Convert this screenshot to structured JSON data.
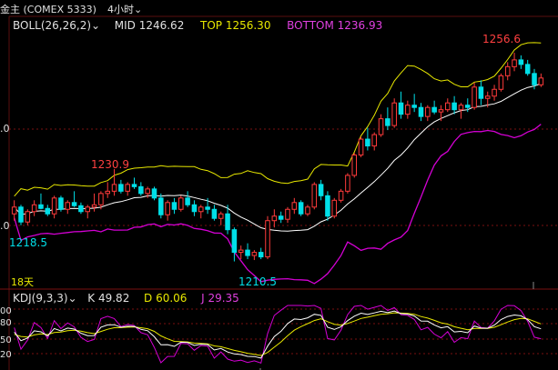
{
  "header": {
    "instrument": "金主 (COMEX 5333)",
    "period": "4小时",
    "period_dropdown_icon": "chevron-down-icon"
  },
  "boll": {
    "label": "BOLL(26,26,2)",
    "mid_label": "MID",
    "mid_value": "1246.62",
    "top_label": "TOP",
    "top_value": "1256.30",
    "bottom_label": "BOTTOM",
    "bottom_value": "1236.93"
  },
  "kdj": {
    "label": "KDJ(9,3,3)",
    "k_label": "K",
    "k_value": "49.82",
    "d_label": "D",
    "d_value": "60.06",
    "j_label": "J",
    "j_value": "29.35"
  },
  "y_ticks": {
    "upper": ".0",
    "lower": ".0",
    "kdj_ticks": [
      "00",
      "80",
      "50",
      "20"
    ]
  },
  "annotations": {
    "high_left": "1230.9",
    "low_left": "1218.5",
    "low_mid": "1210.5",
    "high_right": "1256.6",
    "period_count": "18天"
  },
  "colors": {
    "background": "#000000",
    "up_candle": "#ff3b3b",
    "down_candle": "#00dfe8",
    "mid_line": "#ffffff",
    "top_line": "#e8e800",
    "bottom_line": "#d400d4",
    "grid_red": "#7a1010",
    "text_white": "#e0e0e0",
    "text_yellow": "#e8e800",
    "text_magenta": "#e040e0",
    "text_red": "#ff4040",
    "text_cyan": "#00dfe8"
  },
  "chart_data": {
    "type": "candlestick",
    "title": "",
    "series": [
      {
        "name": "MID",
        "value_last": 1246.62
      },
      {
        "name": "TOP",
        "value_last": 1256.3
      },
      {
        "name": "BOTTOM",
        "value_last": 1236.93
      }
    ],
    "price_range": [
      1208,
      1261
    ],
    "candles_ohlc": [
      [
        1221.0,
        1224.0,
        1219.5,
        1222.5
      ],
      [
        1222.5,
        1223.0,
        1218.5,
        1219.2
      ],
      [
        1219.2,
        1222.0,
        1218.5,
        1221.5
      ],
      [
        1221.5,
        1224.0,
        1220.5,
        1223.0
      ],
      [
        1223.0,
        1225.5,
        1222.0,
        1222.2
      ],
      [
        1222.2,
        1223.0,
        1220.5,
        1221.0
      ],
      [
        1221.0,
        1225.0,
        1220.0,
        1224.5
      ],
      [
        1224.5,
        1225.0,
        1221.5,
        1222.0
      ],
      [
        1222.0,
        1224.0,
        1221.0,
        1223.5
      ],
      [
        1223.5,
        1226.0,
        1222.5,
        1222.8
      ],
      [
        1222.8,
        1223.5,
        1221.0,
        1221.5
      ],
      [
        1221.5,
        1223.0,
        1220.0,
        1222.5
      ],
      [
        1222.5,
        1225.5,
        1221.5,
        1223.0
      ],
      [
        1223.0,
        1226.0,
        1222.0,
        1225.5
      ],
      [
        1225.5,
        1228.0,
        1224.5,
        1226.0
      ],
      [
        1226.0,
        1230.9,
        1225.0,
        1227.5
      ],
      [
        1227.5,
        1228.5,
        1225.5,
        1226.0
      ],
      [
        1226.0,
        1228.0,
        1225.0,
        1227.5
      ],
      [
        1227.5,
        1229.0,
        1226.5,
        1227.0
      ],
      [
        1227.0,
        1228.0,
        1225.0,
        1225.5
      ],
      [
        1225.5,
        1227.0,
        1224.5,
        1226.5
      ],
      [
        1226.5,
        1227.0,
        1224.0,
        1224.5
      ],
      [
        1224.5,
        1225.5,
        1220.0,
        1220.8
      ],
      [
        1220.8,
        1224.0,
        1219.5,
        1223.5
      ],
      [
        1223.5,
        1224.5,
        1221.0,
        1222.0
      ],
      [
        1222.0,
        1225.0,
        1221.5,
        1224.5
      ],
      [
        1224.5,
        1226.0,
        1222.5,
        1223.0
      ],
      [
        1223.0,
        1224.0,
        1220.5,
        1221.5
      ],
      [
        1221.5,
        1223.0,
        1220.0,
        1222.5
      ],
      [
        1222.5,
        1224.5,
        1221.0,
        1222.0
      ],
      [
        1222.0,
        1223.0,
        1219.5,
        1220.0
      ],
      [
        1220.0,
        1221.5,
        1218.5,
        1221.0
      ],
      [
        1221.0,
        1223.0,
        1216.5,
        1217.5
      ],
      [
        1217.5,
        1218.0,
        1210.5,
        1212.5
      ],
      [
        1212.5,
        1214.0,
        1211.0,
        1213.0
      ],
      [
        1213.0,
        1214.5,
        1211.0,
        1211.8
      ],
      [
        1211.8,
        1213.0,
        1210.8,
        1212.5
      ],
      [
        1212.5,
        1213.5,
        1211.0,
        1211.5
      ],
      [
        1211.5,
        1220.5,
        1211.0,
        1219.5
      ],
      [
        1219.5,
        1222.0,
        1218.0,
        1220.5
      ],
      [
        1220.5,
        1221.5,
        1219.0,
        1219.8
      ],
      [
        1219.8,
        1222.5,
        1219.0,
        1222.0
      ],
      [
        1222.0,
        1224.5,
        1221.0,
        1223.5
      ],
      [
        1223.5,
        1224.0,
        1220.5,
        1221.0
      ],
      [
        1221.0,
        1223.0,
        1220.5,
        1222.5
      ],
      [
        1222.5,
        1228.0,
        1222.0,
        1227.5
      ],
      [
        1227.5,
        1228.5,
        1224.0,
        1225.0
      ],
      [
        1225.0,
        1226.0,
        1219.5,
        1220.5
      ],
      [
        1220.5,
        1224.5,
        1220.0,
        1224.0
      ],
      [
        1224.0,
        1226.5,
        1223.5,
        1226.0
      ],
      [
        1226.0,
        1230.0,
        1225.5,
        1229.5
      ],
      [
        1229.5,
        1234.5,
        1229.0,
        1234.0
      ],
      [
        1234.0,
        1238.0,
        1233.5,
        1237.5
      ],
      [
        1237.5,
        1240.0,
        1235.0,
        1236.0
      ],
      [
        1236.0,
        1239.0,
        1235.0,
        1238.5
      ],
      [
        1238.5,
        1243.0,
        1238.0,
        1242.0
      ],
      [
        1242.0,
        1244.5,
        1239.5,
        1240.5
      ],
      [
        1240.5,
        1246.5,
        1240.0,
        1245.5
      ],
      [
        1245.5,
        1248.0,
        1242.0,
        1243.0
      ],
      [
        1243.0,
        1246.0,
        1242.0,
        1245.0
      ],
      [
        1245.0,
        1247.5,
        1243.5,
        1244.5
      ],
      [
        1244.5,
        1245.5,
        1241.5,
        1242.5
      ],
      [
        1242.5,
        1245.0,
        1241.5,
        1244.5
      ],
      [
        1244.5,
        1246.0,
        1243.0,
        1243.5
      ],
      [
        1243.5,
        1245.0,
        1241.5,
        1244.0
      ],
      [
        1244.0,
        1246.5,
        1243.5,
        1245.5
      ],
      [
        1245.5,
        1247.0,
        1243.0,
        1244.0
      ],
      [
        1244.0,
        1245.5,
        1242.0,
        1245.0
      ],
      [
        1245.0,
        1246.5,
        1243.5,
        1244.5
      ],
      [
        1244.5,
        1250.0,
        1244.0,
        1249.0
      ],
      [
        1249.0,
        1250.5,
        1245.0,
        1246.5
      ],
      [
        1246.5,
        1248.0,
        1244.5,
        1247.0
      ],
      [
        1247.0,
        1249.5,
        1246.0,
        1248.5
      ],
      [
        1248.5,
        1252.0,
        1248.0,
        1251.5
      ],
      [
        1251.5,
        1254.5,
        1250.5,
        1253.5
      ],
      [
        1253.5,
        1256.6,
        1252.5,
        1255.0
      ],
      [
        1255.0,
        1256.0,
        1253.0,
        1254.0
      ],
      [
        1254.0,
        1255.0,
        1251.5,
        1252.0
      ],
      [
        1252.0,
        1253.0,
        1248.5,
        1249.5
      ],
      [
        1249.5,
        1252.0,
        1249.0,
        1251.0
      ]
    ],
    "kdj_range": [
      0,
      100
    ],
    "kdj_last": {
      "K": 49.82,
      "D": 60.06,
      "J": 29.35
    }
  }
}
